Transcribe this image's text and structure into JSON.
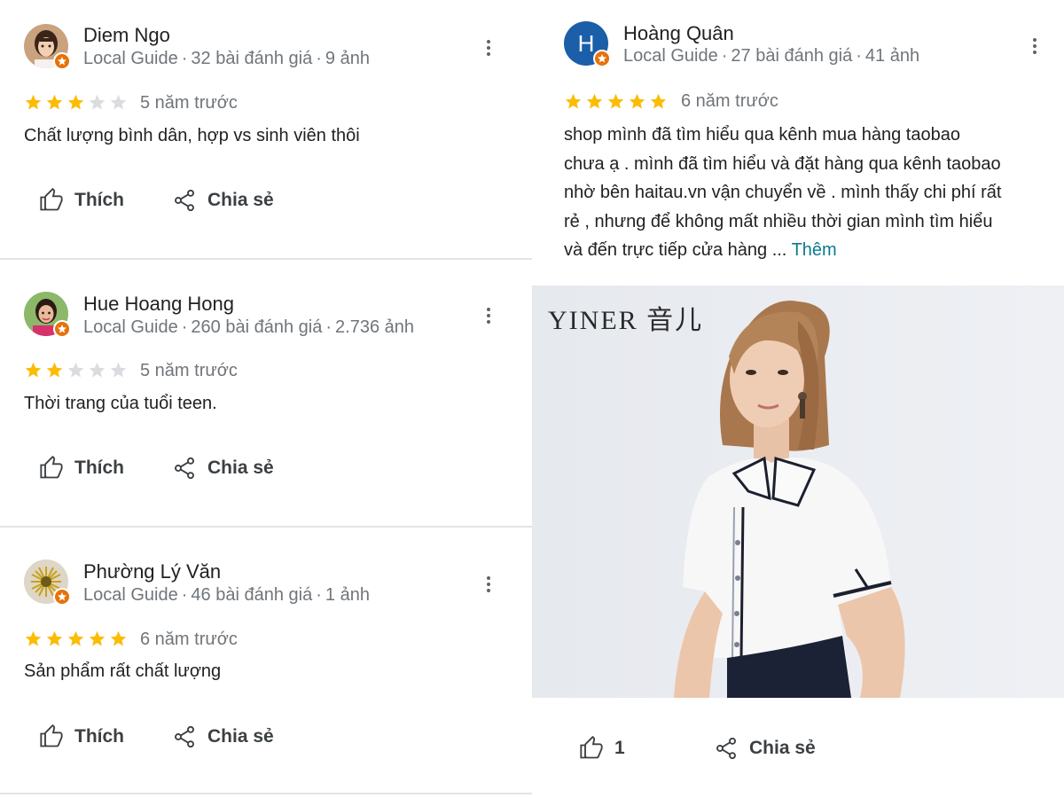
{
  "reviews_left": [
    {
      "name": "Diem Ngo",
      "guide": "Local Guide",
      "reviews": "32 bài đánh giá",
      "photos": "9 ảnh",
      "rating": 3,
      "time": "5 năm trước",
      "text": "Chất lượng bình dân, hợp vs sinh viên thôi",
      "like_label": "Thích",
      "share_label": "Chia sẻ"
    },
    {
      "name": "Hue Hoang Hong",
      "guide": "Local Guide",
      "reviews": "260 bài đánh giá",
      "photos": "2.736 ảnh",
      "rating": 2,
      "time": "5 năm trước",
      "text": "Thời trang của tuổi teen.",
      "like_label": "Thích",
      "share_label": "Chia sẻ"
    },
    {
      "name": "Phường Lý Văn",
      "guide": "Local Guide",
      "reviews": "46 bài đánh giá",
      "photos": "1 ảnh",
      "rating": 5,
      "time": "6 năm trước",
      "text": "Sản phẩm rất chất lượng",
      "like_label": "Thích",
      "share_label": "Chia sẻ"
    }
  ],
  "review_right": {
    "avatar_letter": "H",
    "name": "Hoàng Quân",
    "guide": "Local Guide",
    "reviews": "27 bài đánh giá",
    "photos": "41 ảnh",
    "rating": 5,
    "time": "6 năm trước",
    "text_lines": [
      "shop mình đã tìm hiểu qua kênh mua hàng taobao",
      "chưa ạ . mình đã tìm hiểu và đặt hàng qua kênh taobao",
      "nhờ bên haitau.vn vận chuyển về . mình thấy chi phí rất",
      "rẻ , nhưng để không mất nhiều thời gian mình tìm hiểu",
      "và đến trực tiếp cửa hàng ..."
    ],
    "more_label": "Thêm",
    "photo_brand": "YINER 音儿",
    "like_count": "1",
    "share_label": "Chia sẻ"
  },
  "colors": {
    "star_filled": "#fbbc04",
    "star_empty": "#dadce0",
    "guide_badge": "#e8710a",
    "avatar_h": "#1a5fa8",
    "more_link": "#0b7a8f"
  },
  "icons": {
    "like": "thumb-up-icon",
    "share": "share-icon",
    "menu": "more-vert-icon",
    "star": "star-icon",
    "badge": "local-guide-badge-icon"
  }
}
